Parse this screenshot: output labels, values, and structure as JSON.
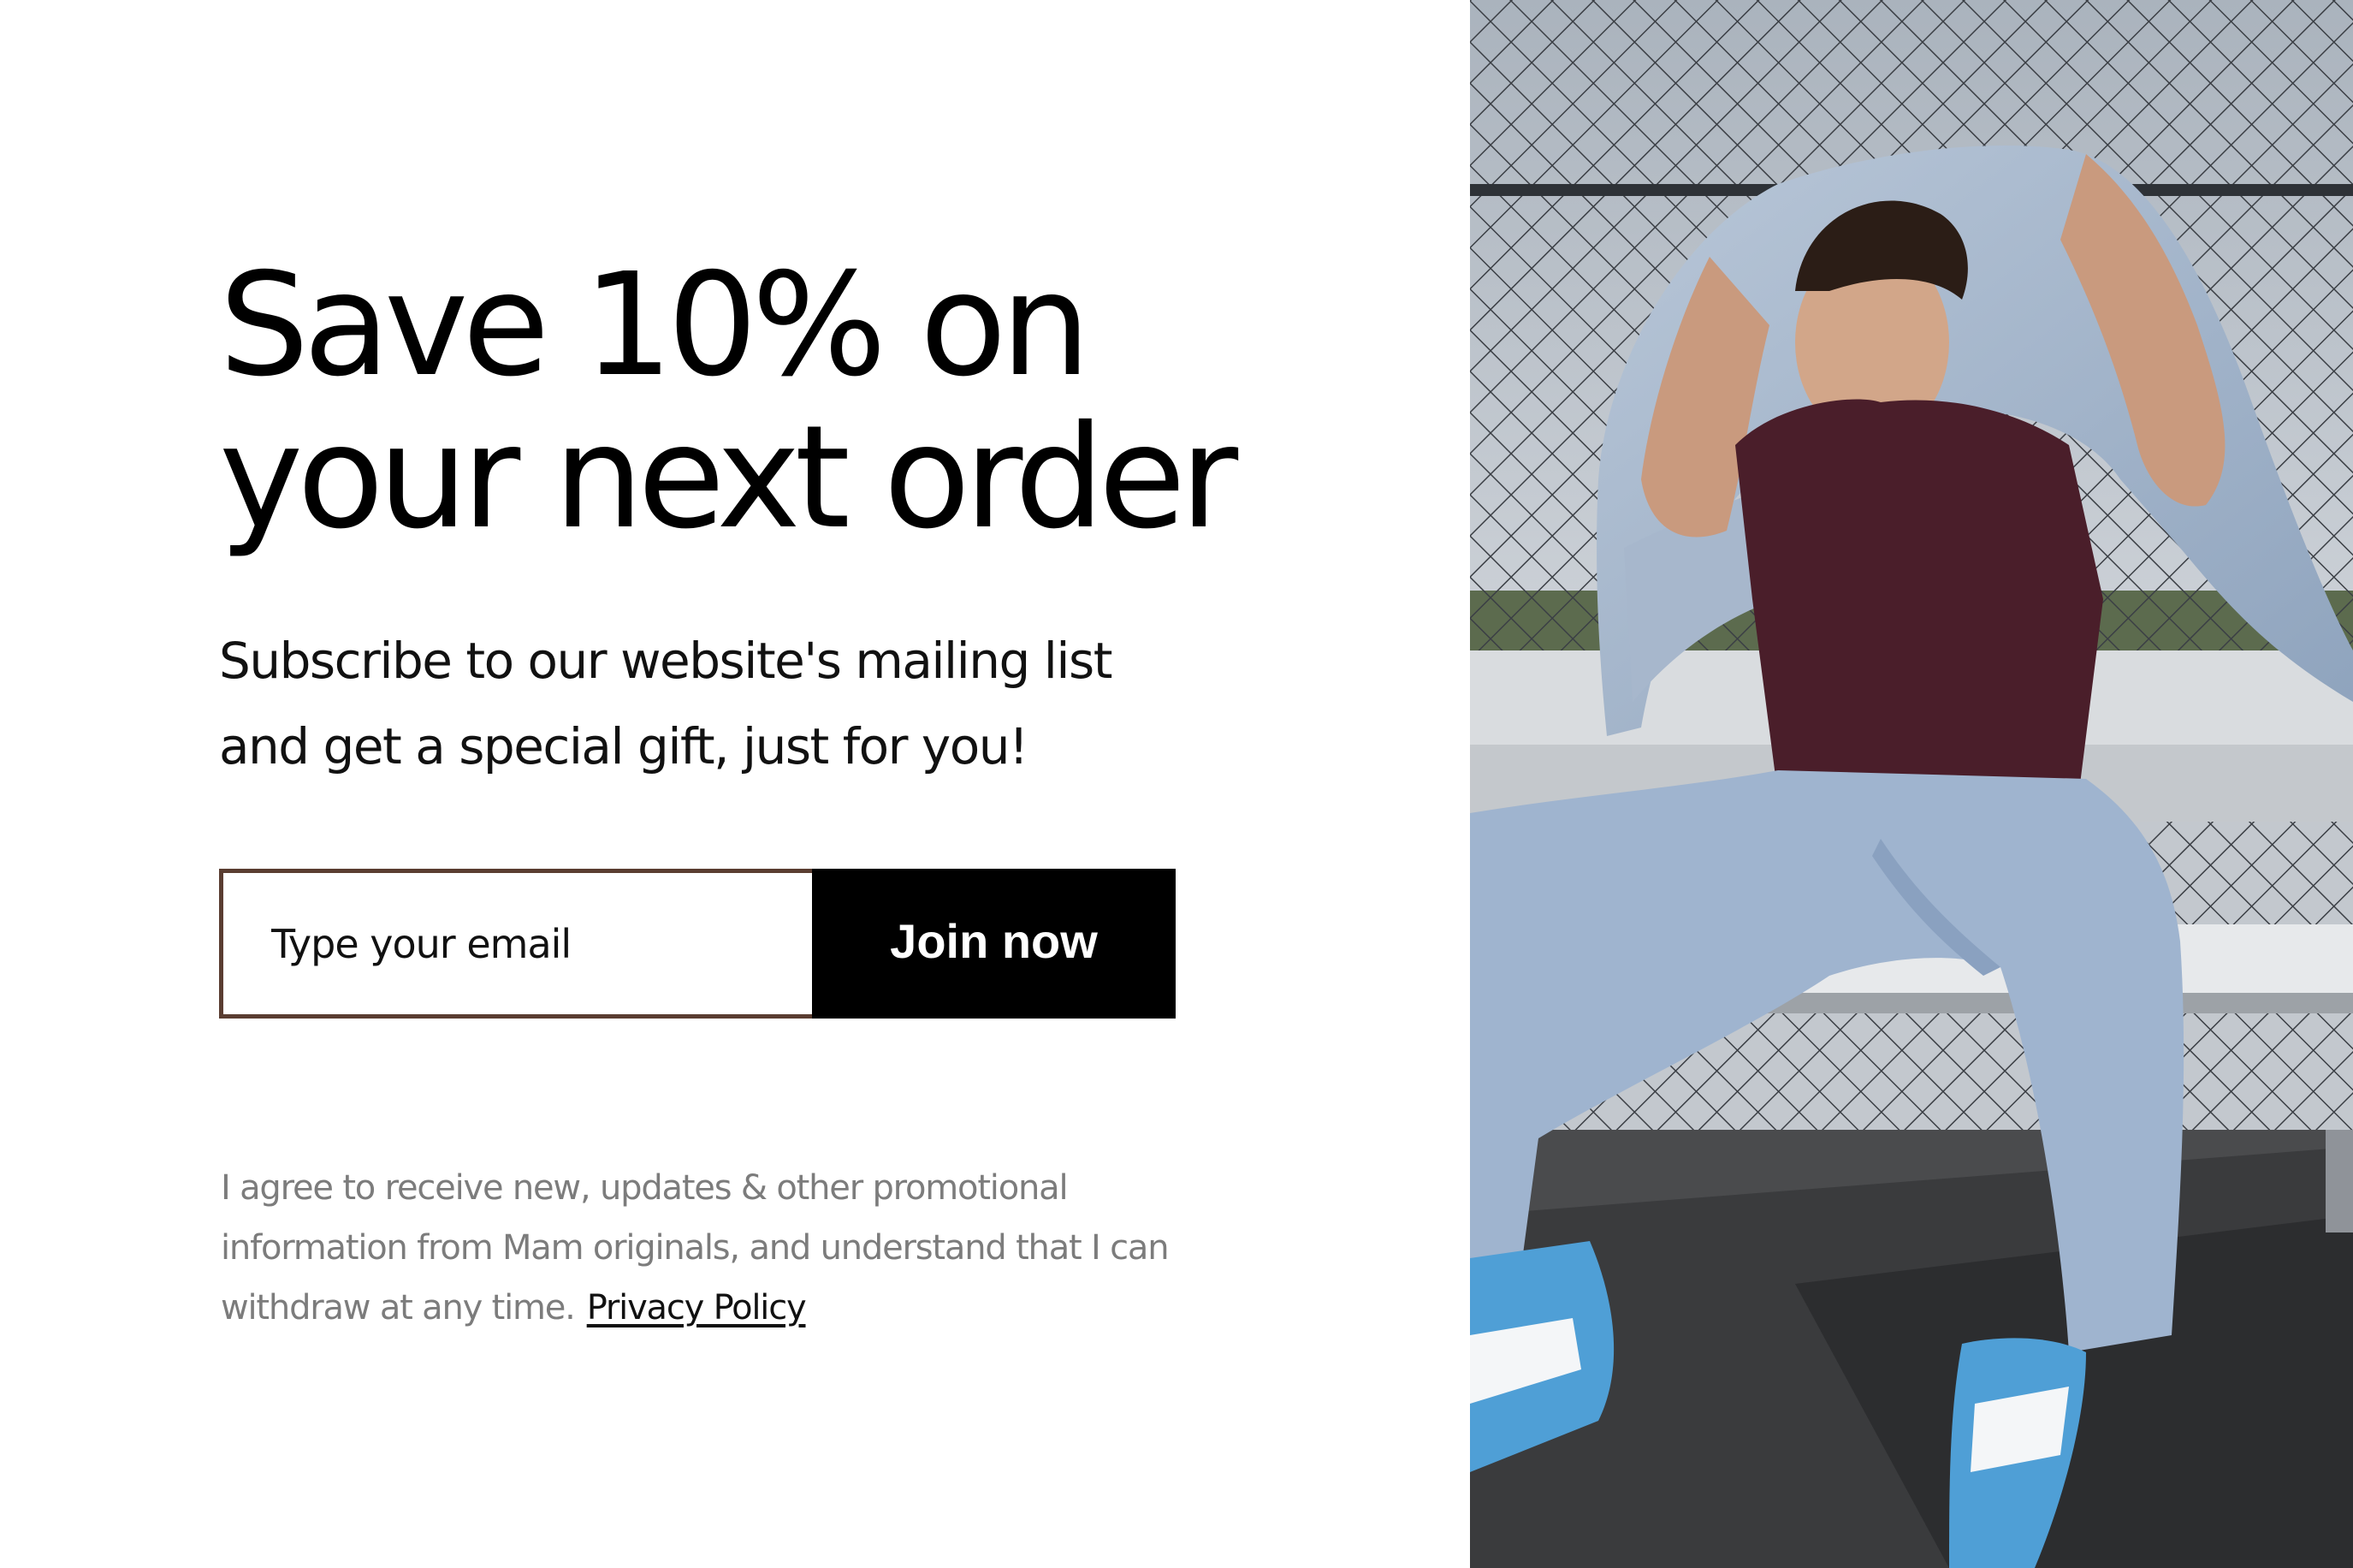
{
  "popup": {
    "headline_line1": "Save 10% on",
    "headline_line2": "your next order",
    "subtitle_line1": "Subscribe to our website's mailing list",
    "subtitle_line2": "and get a special gift, just for you!",
    "email_placeholder": "Type your email",
    "join_label": "Join now",
    "consent_line1": "I agree to receive new, updates & other promotional",
    "consent_line2": "information from Mam originals, and understand that I can",
    "consent_line3": "withdraw at any time.",
    "privacy_label": "Privacy Policy"
  },
  "colors": {
    "button_bg": "#000000",
    "input_border": "#5a3d31",
    "consent_text": "#7c7c7c"
  },
  "hero": {
    "icon": "photo-man-denim-jacket"
  }
}
